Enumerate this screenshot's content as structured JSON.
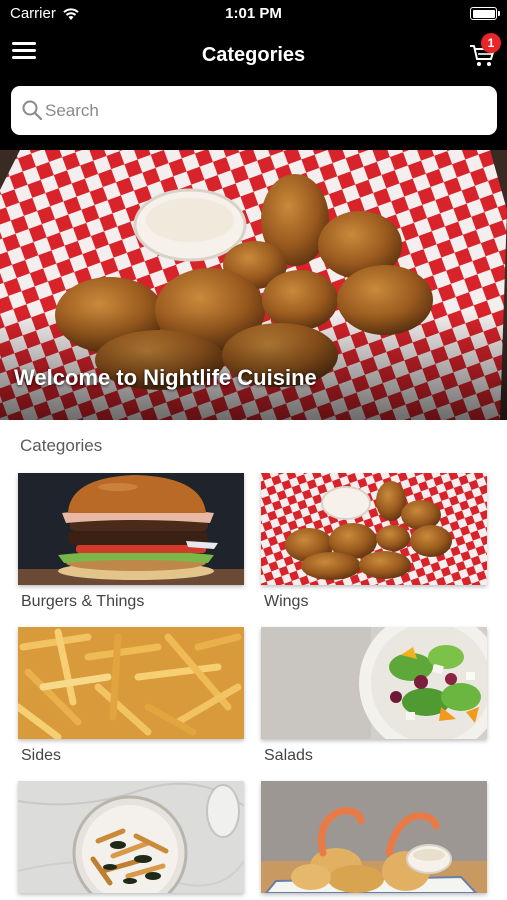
{
  "status_bar": {
    "carrier": "Carrier",
    "time": "1:01 PM",
    "wifi_icon": "wifi-icon",
    "battery_icon": "battery-icon"
  },
  "nav": {
    "title": "Categories",
    "menu_icon": "hamburger-menu-icon",
    "cart_icon": "shopping-cart-icon",
    "cart_count": "1"
  },
  "search": {
    "placeholder": "Search",
    "value": ""
  },
  "hero": {
    "title": "Welcome to Nightlife Cuisine"
  },
  "categories": {
    "heading": "Categories",
    "items": [
      {
        "label": "Burgers & Things"
      },
      {
        "label": "Wings"
      },
      {
        "label": "Sides"
      },
      {
        "label": "Salads"
      },
      {
        "label": ""
      },
      {
        "label": ""
      }
    ]
  },
  "colors": {
    "bar": "#000000",
    "badge": "#e8262a",
    "background": "#ffffff"
  }
}
